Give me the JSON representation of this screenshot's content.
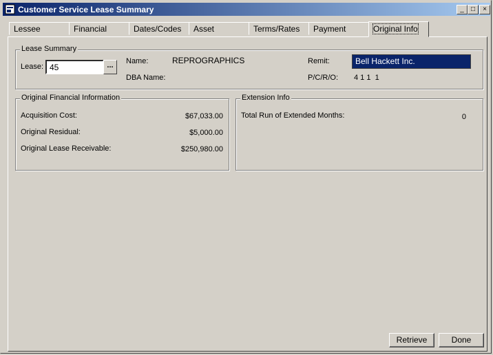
{
  "window": {
    "title": "Customer Service Lease Summary",
    "controls": {
      "minimize": "_",
      "maximize": "□",
      "close": "×"
    }
  },
  "tabs": [
    {
      "label": "Lessee"
    },
    {
      "label": "Financial"
    },
    {
      "label": "Dates/Codes"
    },
    {
      "label": "Asset"
    },
    {
      "label": "Terms/Rates"
    },
    {
      "label": "Payment"
    },
    {
      "label": "Original Info",
      "active": true
    }
  ],
  "lease_summary": {
    "group_title": "Lease Summary",
    "lease_label": "Lease:",
    "lease_value": "45",
    "lookup_button": "...",
    "name_label": "Name:",
    "name_value": "REPROGRAPHICS",
    "dba_label": "DBA Name:",
    "dba_value": "",
    "remit_label": "Remit:",
    "remit_value": "Bell Hackett Inc.",
    "pcro_label": "P/C/R/O:",
    "pcro_value": "4 1 1  1"
  },
  "original_financial": {
    "group_title": "Original Financial Information",
    "rows": [
      {
        "label": "Acquisition Cost:",
        "value": "$67,033.00"
      },
      {
        "label": "Original Residual:",
        "value": "$5,000.00"
      },
      {
        "label": "Original Lease Receivable:",
        "value": "$250,980.00"
      }
    ]
  },
  "extension_info": {
    "group_title": "Extension Info",
    "label": "Total Run of Extended Months:",
    "value": "0"
  },
  "buttons": {
    "retrieve": "Retrieve",
    "done": "Done"
  },
  "colors": {
    "titlebar_start": "#0a246a",
    "titlebar_end": "#a6caf0",
    "remit_bg": "#0a246a",
    "face": "#d4d0c8"
  }
}
